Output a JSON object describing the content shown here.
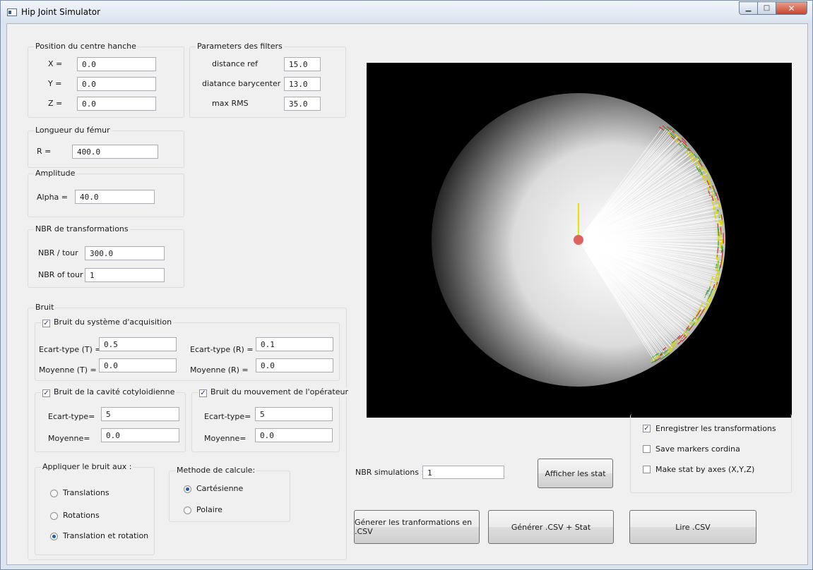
{
  "window": {
    "title": "Hip Joint Simulator",
    "min_icon": "minimize-icon",
    "max_icon": "maximize-icon",
    "close_icon": "close-icon"
  },
  "position": {
    "title": "Position du centre hanche",
    "x_label": "X =",
    "x_value": "0.0",
    "y_label": "Y =",
    "y_value": "0.0",
    "z_label": "Z =",
    "z_value": "0.0"
  },
  "filters": {
    "title": "Parameters des filters",
    "ref_label": "distance ref",
    "ref_value": "15.0",
    "bary_label": "diatance barycenter",
    "bary_value": "13.0",
    "rms_label": "max RMS",
    "rms_value": "35.0"
  },
  "femur": {
    "title": "Longueur du fémur",
    "r_label": "R =",
    "r_value": "400.0"
  },
  "amplitude": {
    "title": "Amplitude",
    "alpha_label": "Alpha =",
    "alpha_value": "40.0"
  },
  "transforms": {
    "title": "NBR de transformations",
    "per_tour_label": "NBR / tour",
    "per_tour_value": "300.0",
    "tours_label": "NBR of tour :",
    "tours_value": "1"
  },
  "noise": {
    "title": "Bruit",
    "acquisition": {
      "label": "Bruit du système d'acquisition",
      "checked": true,
      "ecart_t_label": "Ecart-type (T) =",
      "ecart_t_value": "0.5",
      "ecart_r_label": "Ecart-type (R) =",
      "ecart_r_value": "0.1",
      "moyenne_t_label": "Moyenne (T) =",
      "moyenne_t_value": "0.0",
      "moyenne_r_label": "Moyenne (R) =",
      "moyenne_r_value": "0.0"
    },
    "cavity": {
      "label": "Bruit de la cavité cotyloidienne",
      "checked": true,
      "ecart_label": "Ecart-type=",
      "ecart_value": "5",
      "moyenne_label": "Moyenne=",
      "moyenne_value": "0.0"
    },
    "operator": {
      "label": "Bruit du  mouvement de l'opérateur",
      "checked": true,
      "ecart_label": "Ecart-type=",
      "ecart_value": "5",
      "moyenne_label": "Moyenne=",
      "moyenne_value": "0.0"
    }
  },
  "apply_noise": {
    "title": "Appliquer le bruit aux :",
    "options": [
      "Translations",
      "Rotations",
      "Translation et rotation"
    ],
    "selected": "Translation et rotation"
  },
  "method": {
    "title": "Methode de calcule:",
    "options": [
      "Cartésienne",
      "Polaire"
    ],
    "selected": "Cartésienne"
  },
  "options": {
    "save_transforms": "Enregistrer les transformations",
    "save_transforms_checked": true,
    "save_markers": "Save markers cordina",
    "save_markers_checked": false,
    "stat_axes": "Make stat by axes (X,Y,Z)",
    "stat_axes_checked": false
  },
  "simulations": {
    "label": "NBR simulations :",
    "value": "1"
  },
  "buttons": {
    "show_stats": "Afficher les stat",
    "generate_csv": "Génerer les tranformations en .CSV",
    "generate_csv_stat": "Générer  .CSV + Stat",
    "read_csv": "Lire .CSV"
  },
  "colors": {
    "viewport_bg": "#000000",
    "sphere_light": "#ffffff",
    "sphere_dark": "#262626",
    "center_marker": "#e06060",
    "axis_marker": "#e8e000",
    "ray": "#ffffff",
    "marker_yellow": "#d8d800",
    "marker_red": "#c83030",
    "marker_green": "#3aa035"
  }
}
